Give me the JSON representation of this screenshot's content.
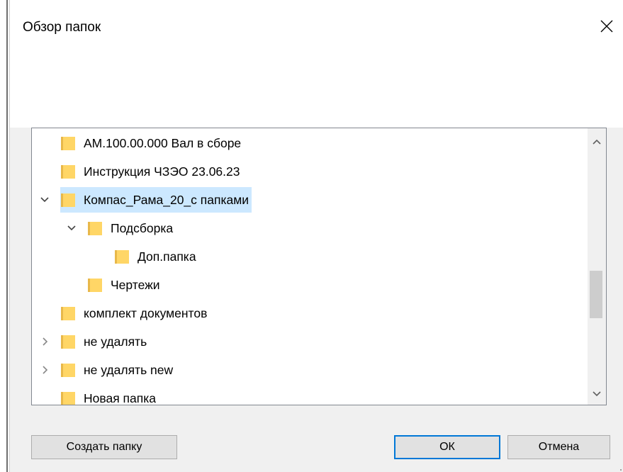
{
  "window": {
    "title": "Обзор папок"
  },
  "tree": {
    "items": [
      {
        "label": "АМ.100.00.000 Вал в сборе",
        "level": 1,
        "expander": "none",
        "selected": false
      },
      {
        "label": "Инструкция ЧЗЭО 23.06.23",
        "level": 1,
        "expander": "none",
        "selected": false
      },
      {
        "label": "Компас_Рама_20_с папками",
        "level": 1,
        "expander": "expanded",
        "selected": true
      },
      {
        "label": "Подсборка",
        "level": 2,
        "expander": "expanded",
        "selected": false
      },
      {
        "label": "Доп.папка",
        "level": 3,
        "expander": "none",
        "selected": false
      },
      {
        "label": "Чертежи",
        "level": 2,
        "expander": "none",
        "selected": false
      },
      {
        "label": "комплект документов",
        "level": 1,
        "expander": "none",
        "selected": false
      },
      {
        "label": "не удалять",
        "level": 1,
        "expander": "collapsed",
        "selected": false
      },
      {
        "label": "не удалять new",
        "level": 1,
        "expander": "collapsed",
        "selected": false
      },
      {
        "label": "Новая папка",
        "level": 1,
        "expander": "none",
        "selected": false
      }
    ],
    "scroll_position": 0.55
  },
  "buttons": {
    "new_folder": "Создать папку",
    "ok": "ОК",
    "cancel": "Отмена"
  },
  "icons": {
    "close": "close-icon",
    "folder": "folder-icon",
    "expanded": "chevron-down-icon",
    "collapsed": "chevron-right-icon",
    "scroll_up": "scroll-up-arrow-icon",
    "scroll_down": "scroll-down-arrow-icon"
  },
  "colors": {
    "selection": "#cce8ff",
    "default_button_border": "#0078d7",
    "folder_fill": "#ffd666",
    "folder_shade": "#e8b84a"
  }
}
